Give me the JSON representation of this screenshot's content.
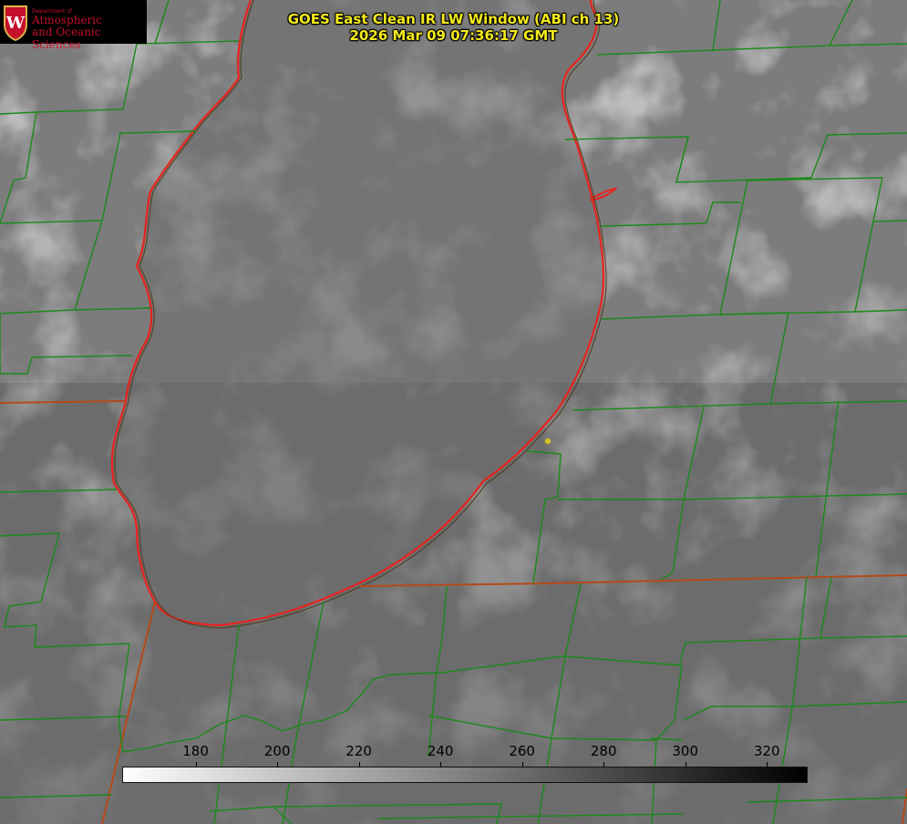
{
  "title": {
    "line1": "GOES East Clean IR LW Window (ABI ch 13)",
    "line2": "2026 Mar 09 07:36:17 GMT"
  },
  "logo": {
    "dept_label": "Department of",
    "line1": "Atmospheric",
    "line2": "and Oceanic Sciences",
    "seal_letter": "W"
  },
  "colorbar": {
    "tick_values": [
      180,
      200,
      220,
      240,
      260,
      280,
      300,
      320
    ],
    "range_min": 162,
    "range_max": 330,
    "gradient_start_color": "#ffffff",
    "gradient_end_color": "#000000"
  },
  "colors": {
    "title_text": "#f4ea1a",
    "county_lines": "#1a8a1a",
    "coastline": "#e8231e",
    "state_line": "#b5491a",
    "marker": "#d4c322"
  },
  "icons": {
    "marker": "yellow-dot-marker",
    "logo_seal": "uw-crest-icon"
  }
}
